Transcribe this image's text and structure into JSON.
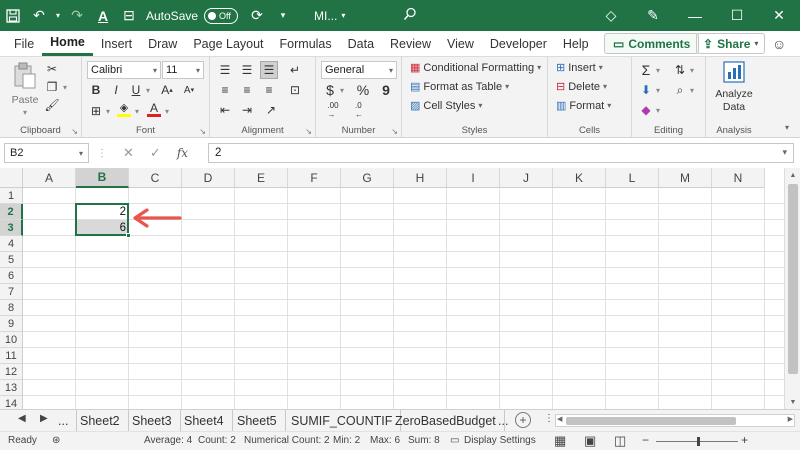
{
  "titlebar": {
    "autosave_label": "AutoSave",
    "autosave_state": "Off",
    "doc_title": "MI...",
    "icons": [
      "save-icon",
      "undo-icon",
      "redo-icon",
      "quick-access-icon",
      "font-color-qat-icon",
      "sync-icon",
      "more-qat-icon",
      "search-icon",
      "gem-icon",
      "pen-icon",
      "minimize-icon",
      "maximize-icon",
      "close-icon"
    ]
  },
  "menu": {
    "tabs": [
      "File",
      "Home",
      "Insert",
      "Draw",
      "Page Layout",
      "Formulas",
      "Data",
      "Review",
      "View",
      "Developer",
      "Help"
    ],
    "active": "Home",
    "comments_label": "Comments",
    "share_label": "Share"
  },
  "ribbon": {
    "clipboard": {
      "label": "Clipboard",
      "paste_label": "Paste"
    },
    "font": {
      "label": "Font",
      "font_name": "Calibri",
      "font_size": "11",
      "bold": "B",
      "italic": "I",
      "underline": "U"
    },
    "alignment": {
      "label": "Alignment"
    },
    "number": {
      "label": "Number",
      "format": "General",
      "currency": "$",
      "percent": "%",
      "comma": "9"
    },
    "styles": {
      "label": "Styles",
      "conditional": "Conditional Formatting",
      "table": "Format as Table",
      "cell_styles": "Cell Styles"
    },
    "cells": {
      "label": "Cells",
      "insert": "Insert",
      "delete": "Delete",
      "format": "Format"
    },
    "editing": {
      "label": "Editing"
    },
    "analysis": {
      "label": "Analysis",
      "analyze_line1": "Analyze",
      "analyze_line2": "Data"
    }
  },
  "formula_bar": {
    "name_box": "B2",
    "fx": "fx",
    "value": "2"
  },
  "grid": {
    "columns": [
      "A",
      "B",
      "C",
      "D",
      "E",
      "F",
      "G",
      "H",
      "I",
      "J",
      "K",
      "L",
      "M",
      "N"
    ],
    "rows": [
      "1",
      "2",
      "3",
      "4",
      "5",
      "6",
      "7",
      "8",
      "9",
      "10",
      "11",
      "12",
      "13",
      "14"
    ],
    "selected_column": "B",
    "selected_rows": [
      "2",
      "3"
    ],
    "cells": {
      "B2": "2",
      "B3": "6"
    }
  },
  "sheets": {
    "tabs": [
      "...",
      "Sheet2",
      "Sheet3",
      "Sheet4",
      "Sheet5",
      "SUMIF_COUNTIF",
      "ZeroBasedBudget",
      "..."
    ]
  },
  "status": {
    "ready": "Ready",
    "average": "Average: 4",
    "count": "Count: 2",
    "numerical_count": "Numerical Count: 2",
    "min": "Min: 2",
    "max": "Max: 6",
    "sum": "Sum: 8",
    "display_settings": "Display Settings",
    "zoom_level_percent": 100,
    "colors": {
      "accent": "#217346",
      "annotation": "#e8554e"
    }
  }
}
